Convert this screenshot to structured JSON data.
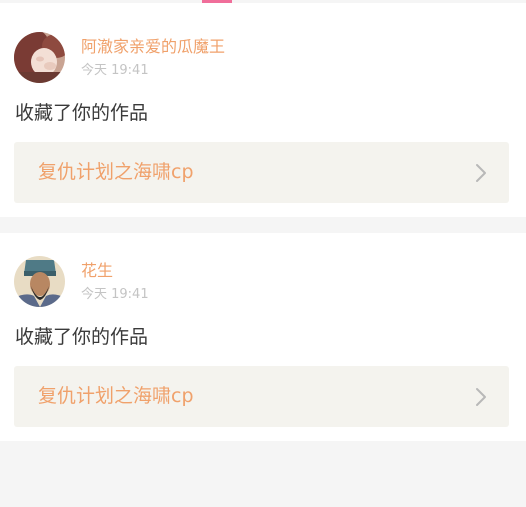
{
  "notifications": [
    {
      "username": "阿澈家亲爱的瓜魔王",
      "time": "今天 19:41",
      "action": "收藏了你的作品",
      "work_title": "复仇计划之海啸cp"
    },
    {
      "username": "花生",
      "time": "今天 19:41",
      "action": "收藏了你的作品",
      "work_title": "复仇计划之海啸cp"
    }
  ],
  "icons": {
    "chevron": "chevron-right-icon"
  },
  "colors": {
    "accent": "#f0a16b",
    "tab_indicator": "#f06e9a",
    "link_bg": "#f4f3ee",
    "page_bg": "#f5f5f5",
    "time": "#c4c4c4",
    "text": "#3a3a3a"
  }
}
